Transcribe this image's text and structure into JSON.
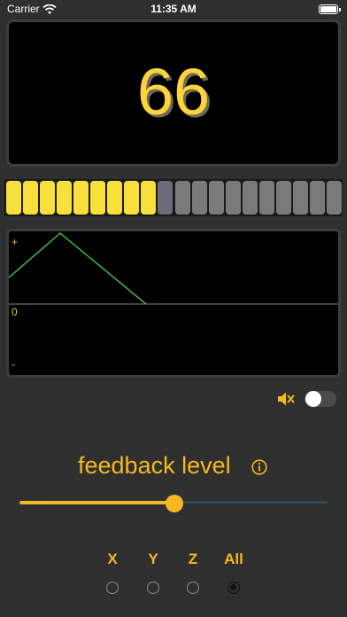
{
  "status_bar": {
    "carrier": "Carrier",
    "time": "11:35 AM"
  },
  "display": {
    "value": "66"
  },
  "meter": {
    "total_segments": 20,
    "lit_segments": 9,
    "lit_color": "#f7e03c",
    "next_color": "#6b6b7a",
    "off_color": "#7a7a7a"
  },
  "waveform": {
    "plus_label": "+",
    "zero_label": "0",
    "minus_label": "-",
    "line_color": "#3fae3f"
  },
  "sound": {
    "mute_icon": "speaker-muted-icon",
    "toggle_on": false
  },
  "feedback": {
    "title": "feedback level",
    "info_icon": "info-icon",
    "slider_fraction": 0.5
  },
  "axes": {
    "options": [
      "X",
      "Y",
      "Z",
      "All"
    ],
    "selected": "All"
  },
  "colors": {
    "accent": "#f5b821",
    "background": "#2f2f2f"
  }
}
